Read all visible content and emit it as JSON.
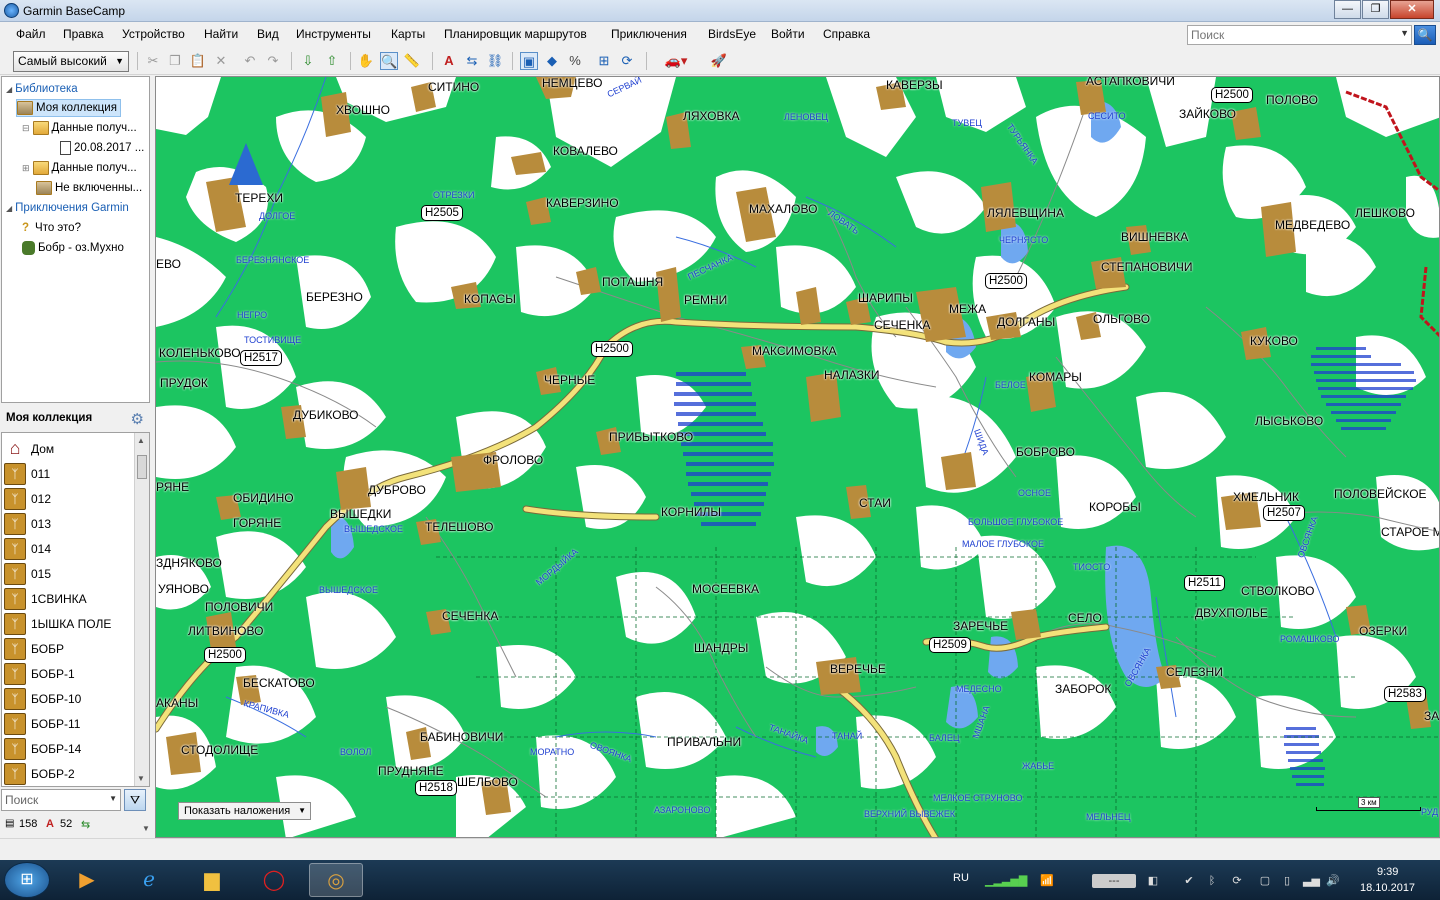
{
  "window": {
    "title": "Garmin BaseCamp",
    "buttons": {
      "minimize": "—",
      "maximize": "❐",
      "close": "✕"
    }
  },
  "menu": [
    "Файл",
    "Правка",
    "Устройство",
    "Найти",
    "Вид",
    "Инструменты",
    "Карты",
    "Планировщик маршрутов",
    "Приключения",
    "BirdsEye",
    "Войти",
    "Справка"
  ],
  "search": {
    "placeholder": "Поиск",
    "go": "🔍"
  },
  "toolbar": {
    "detail_level": "Самый высокий"
  },
  "library": {
    "title": "Библиотека",
    "my_collection": "Моя коллекция",
    "data_1": "Данные получ...",
    "date_item": "20.08.2017 ...",
    "data_2": "Данные получ...",
    "not_included": "Не включенны...",
    "adventures": "Приключения Garmin",
    "what_is": "Что это?",
    "adventure_item": "Бобр - оз.Мухно"
  },
  "collection": {
    "header": "Моя коллекция",
    "items": [
      "Дом",
      "011",
      "012",
      "013",
      "014",
      "015",
      "1СВИНКА",
      "1ЫШКА ПОЛЕ",
      "БОБР",
      "БОБР-1",
      "БОБР-10",
      "БОБР-11",
      "БОБР-14",
      "БОБР-2"
    ]
  },
  "bottom": {
    "search": "Поиск",
    "count_waypoints": "158",
    "count_tracks": "52"
  },
  "map": {
    "overlay_button": "Показать наложения",
    "scale": "3 км",
    "towns": [
      {
        "t": "НЕМЦЕВО"
      },
      {
        "t": "СИТИНО"
      },
      {
        "t": "ХВОШНО"
      },
      {
        "t": "ЛЯХОВКА"
      },
      {
        "t": "КАВЕРЗЫ"
      },
      {
        "t": "АСТАПКОВИЧИ"
      },
      {
        "t": "ЗАЙКОВО"
      },
      {
        "t": "ПОЛОВО"
      },
      {
        "t": "КОВАЛЕВО"
      },
      {
        "t": "ТЕРЕХИ"
      },
      {
        "t": "КАВЕРЗИНО"
      },
      {
        "t": "МАХАЛОВО"
      },
      {
        "t": "ЛЯЛЕВЩИНА"
      },
      {
        "t": "ЛЕШКОВО"
      },
      {
        "t": "МЕДВЕДЕВО"
      },
      {
        "t": "ВИШНЕВКА"
      },
      {
        "t": "СТЕПАНОВИЧИ"
      },
      {
        "t": "ПОТАШНЯ"
      },
      {
        "t": "РЕМНИ"
      },
      {
        "t": "ШАРИПЫ"
      },
      {
        "t": "МЕЖА"
      },
      {
        "t": "БЕРЕЗНО"
      },
      {
        "t": "КОПАСЫ"
      },
      {
        "t": "СЕЧЕНКА"
      },
      {
        "t": "ДОЛГАНЫ"
      },
      {
        "t": "ОЛЬГОВО"
      },
      {
        "t": "КУКОВО"
      },
      {
        "t": "КОЛЕНЬКОВО"
      },
      {
        "t": "МАКСИМОВКА"
      },
      {
        "t": "ПРУДОК"
      },
      {
        "t": "ЧЕРНЫЕ"
      },
      {
        "t": "НАЛАЗКИ"
      },
      {
        "t": "КОМАРЫ"
      },
      {
        "t": "ДУБИКОВО"
      },
      {
        "t": "ЛЫСЬКОВО"
      },
      {
        "t": "ПРИБЫТКОВО"
      },
      {
        "t": "БОБРОВО"
      },
      {
        "t": "ФРОЛОВО"
      },
      {
        "t": "ДУБРОВО"
      },
      {
        "t": "ОБИДИНО"
      },
      {
        "t": "ХМЕЛЬНИК"
      },
      {
        "t": "ПОЛОВЕЙСКОЕ"
      },
      {
        "t": "СТАИ"
      },
      {
        "t": "КОРОБЫ"
      },
      {
        "t": "ВЫШЕДКИ"
      },
      {
        "t": "КОРНИЛЫ"
      },
      {
        "t": "ГОРЯНЕ"
      },
      {
        "t": "ТЕЛЕШОВО"
      },
      {
        "t": "СТАРОЕ М"
      },
      {
        "t": "ЗДНЯКОВО"
      },
      {
        "t": "УЯНОВО"
      },
      {
        "t": "МОСЕЕВКА"
      },
      {
        "t": "СТВОЛКОВО"
      },
      {
        "t": "ПОЛОВИЧИ"
      },
      {
        "t": "СЕЧЕНКА"
      },
      {
        "t": "ДВУХПОЛЬЕ"
      },
      {
        "t": "ЛИТВИНОВО"
      },
      {
        "t": "ЗАРЕЧЬЕ"
      },
      {
        "t": "СЕЛО"
      },
      {
        "t": "ОЗЕРКИ"
      },
      {
        "t": "ШАНДРЫ"
      },
      {
        "t": "ВЕРЕЧЬЕ"
      },
      {
        "t": "СЕЛЕЗНИ"
      },
      {
        "t": "БЕСКАТОВО"
      },
      {
        "t": "ЗАБОРОК"
      },
      {
        "t": "АКАНЫ"
      },
      {
        "t": "БАБИНОВИЧИ"
      },
      {
        "t": "ПРИВАЛЬНИ"
      },
      {
        "t": "СТОДОЛИЩЕ"
      },
      {
        "t": "ПРУДНЯНЕ"
      },
      {
        "t": "ШЕЛБОВО"
      },
      {
        "t": "ЕВО"
      },
      {
        "t": "РЯНЕ"
      },
      {
        "t": "ЗА"
      }
    ],
    "waters": [
      "СЕРВАЙ",
      "ЛЕНОВЕЦ",
      "ТУВЕЦ",
      "СЕСИТО",
      "ТУРЬЯНКА",
      "ОТРЕЗКИ",
      "ДОЛГОЕ",
      "БЕРЕЗНЯНСКОЕ",
      "ЧЕРНЯСТО",
      "НЕГРО",
      "ТОСТИВИЩЕ",
      "ЛОВАТЬ",
      "ПЕСЧАНКА",
      "БЕЛОЕ",
      "ВЫШЕДСКОЕ",
      "ОСНОЕ",
      "БОЛЬШОЕ ГЛУБОКОЕ",
      "МАЛОЕ ГЛУБОКОЕ",
      "ТИОСТО",
      "МОРДЫЙКА",
      "ВЫШЕДСКОЕ",
      "РОМАШКОВО",
      "ОВСЯНКА",
      "МЕДЕСНО",
      "КРАПИВКА",
      "ТАНАЙКА",
      "ТАНАЙ",
      "БАЛЕЦ",
      "МШАНА",
      "ЖАБЬЕ",
      "ВОЛОЛ",
      "МОРАТНО",
      "ОВОЯНКА",
      "МЕЛКОЕ СТРУНОВО",
      "АЗАРОНОВО",
      "ВЕРХНИЙ ВЫВЕЖЕК",
      "МЕЛЬНЕЦ",
      "ШИДА",
      "ОВСЯНКА",
      "РУД"
    ],
    "shields": [
      "Н2500",
      "Н2505",
      "Н2517",
      "Н2500",
      "Н2500",
      "Н2507",
      "Н2511",
      "Н2500",
      "Н2509",
      "Н2583",
      "Н2518"
    ]
  },
  "tray": {
    "lang": "RU",
    "time": "9:39",
    "date": "18.10.2017"
  },
  "colors": {
    "forest": "#1cc561",
    "clearing": "#ffffff",
    "settlement": "#b88c3c",
    "road": "#f3e27a",
    "water": "#6fa8f0"
  }
}
